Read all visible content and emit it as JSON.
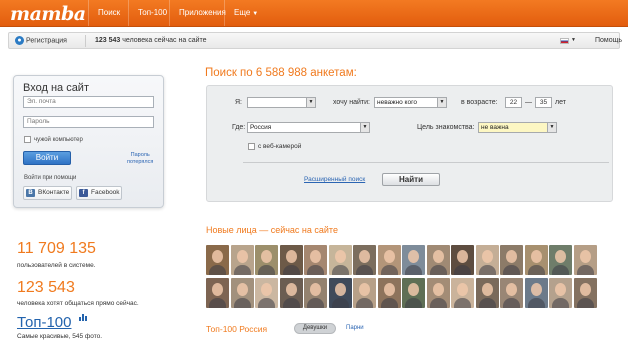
{
  "header": {
    "logo": "mamba",
    "nav": [
      "Поиск",
      "Топ-100",
      "Приложения",
      "Еще"
    ]
  },
  "subbar": {
    "register": "Регистрация",
    "online_count": "123 543",
    "online_text": "человека сейчас на сайте",
    "help": "Помощь"
  },
  "login": {
    "title": "Вход на сайт",
    "email_placeholder": "Эл. почта",
    "password_placeholder": "Пароль",
    "foreign_computer": "чужой компьютер",
    "submit": "Войти",
    "forgot_line1": "Пароль",
    "forgot_line2": "потерялся",
    "via": "Войти при помощи",
    "vk": "ВКонтакте",
    "facebook": "Facebook"
  },
  "stats": {
    "users_count": "11 709 135",
    "users_label": "пользователей в системе.",
    "want_count": "123 543",
    "want_label": "человека хотят общаться прямо сейчас.",
    "top100": "Топ-100",
    "top100_label": "Самые красивые, 545 фото."
  },
  "search": {
    "title": "Поиск по 6 588 988 анкетам:",
    "i_label": "Я:",
    "i_value": "",
    "want_label": "хочу найти:",
    "want_value": "неважно кого",
    "age_label": "в возрасте:",
    "age_from": "22",
    "age_dash": "—",
    "age_to": "35",
    "age_unit": "лет",
    "where_label": "Где:",
    "where_value": "Россия",
    "goal_label": "Цель знакомства:",
    "goal_value": "не важна",
    "webcam": "с веб-камерой",
    "advanced": "Расширенный поиск",
    "find": "Найти"
  },
  "faces": {
    "title": "Новые лица — сейчас на сайте",
    "colors": [
      "#8a6a4a",
      "#b8a48c",
      "#9c8f6b",
      "#6d5a48",
      "#a58770",
      "#c6b59a",
      "#7c6e5e",
      "#b39579",
      "#7e8c9a",
      "#a08a74",
      "#5e4d40",
      "#c4ae96",
      "#8c7b68",
      "#a7906f",
      "#6f7d6a",
      "#b59e86",
      "#7d6452",
      "#a2917d",
      "#cbb7a1",
      "#6b5d52",
      "#94826f",
      "#3f4a5a",
      "#b7a088",
      "#8d735c",
      "#5f6f55",
      "#a38c76",
      "#cab39b",
      "#7a6a5b",
      "#998675",
      "#6c7a8a",
      "#b4a18d",
      "#847160"
    ]
  },
  "top100_ru": {
    "title": "Топ-100 Россия",
    "girls": "Девушки",
    "guys": "Парни"
  }
}
